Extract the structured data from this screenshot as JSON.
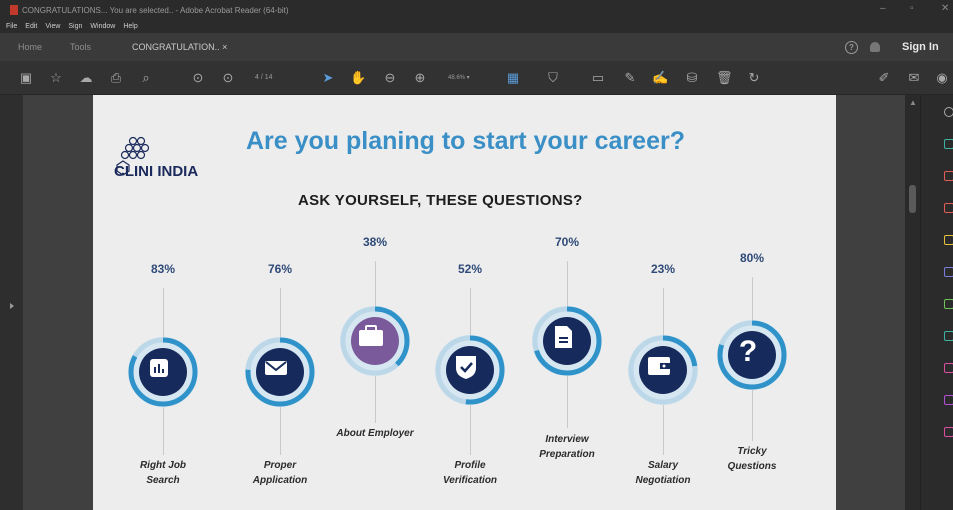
{
  "window": {
    "title": "CONGRATULATIONS... You are selected.. - Adobe Acrobat Reader (64-bit)",
    "controls": [
      "–",
      "▫",
      "✕"
    ]
  },
  "menu": [
    "File",
    "Edit",
    "View",
    "Sign",
    "Window",
    "Help"
  ],
  "tabs": [
    {
      "label": "Home"
    },
    {
      "label": "Tools"
    },
    {
      "label": "CONGRATULATION.. ×"
    }
  ],
  "header_right": {
    "help": "?",
    "signin": "Sign In"
  },
  "toolbar": {
    "page_current": "4",
    "page_total": "/ 14",
    "zoom": "48.6%  ▾"
  },
  "document": {
    "logo_text": "CLINI INDIA",
    "headline": "Are you planing to start your career?",
    "subhead": "ASK YOURSELF, THESE QUESTIONS?",
    "questions": [
      {
        "percent": "83%",
        "label_line1": "Right Job",
        "label_line2": "Search",
        "icon": "chart-icon"
      },
      {
        "percent": "76%",
        "label_line1": "Proper",
        "label_line2": "Application",
        "icon": "envelope-icon"
      },
      {
        "percent": "38%",
        "label_line1": "About Employer",
        "label_line2": "",
        "icon": "briefcase-icon"
      },
      {
        "percent": "52%",
        "label_line1": "Profile",
        "label_line2": "Verification",
        "icon": "shield-check-icon"
      },
      {
        "percent": "70%",
        "label_line1": "Interview",
        "label_line2": "Preparation",
        "icon": "document-icon"
      },
      {
        "percent": "23%",
        "label_line1": "Salary",
        "label_line2": "Negotiation",
        "icon": "wallet-icon"
      },
      {
        "percent": "80%",
        "label_line1": "Tricky",
        "label_line2": "Questions",
        "icon": "question-icon"
      }
    ]
  },
  "colors": {
    "headline": "#3a8fc6",
    "icon_dark": "#172a5c",
    "icon_purple": "#7a5a9a",
    "ring_accent": "#2f93c9"
  }
}
